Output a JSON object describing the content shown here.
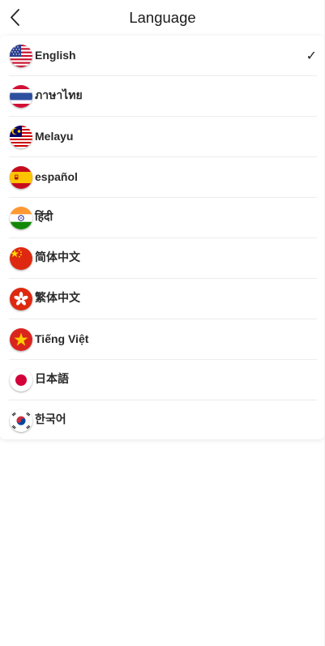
{
  "header": {
    "title": "Language"
  },
  "languages": [
    {
      "label": "English",
      "flag": "us-flag-icon",
      "selected": true
    },
    {
      "label": "ภาษาไทย",
      "flag": "thailand-flag-icon",
      "selected": false
    },
    {
      "label": "Melayu",
      "flag": "malaysia-flag-icon",
      "selected": false
    },
    {
      "label": "español",
      "flag": "spain-flag-icon",
      "selected": false
    },
    {
      "label": "हिंदी",
      "flag": "india-flag-icon",
      "selected": false
    },
    {
      "label": "简体中文",
      "flag": "china-flag-icon",
      "selected": false
    },
    {
      "label": "繁体中文",
      "flag": "hong-kong-flag-icon",
      "selected": false
    },
    {
      "label": "Tiếng Việt",
      "flag": "vietnam-flag-icon",
      "selected": false
    },
    {
      "label": "日本語",
      "flag": "japan-flag-icon",
      "selected": false
    },
    {
      "label": "한국어",
      "flag": "south-korea-flag-icon",
      "selected": false
    }
  ],
  "selected_mark": "✓",
  "colors": {
    "background": "#ffffff",
    "text": "#2a2a2a",
    "divider": "#ececec"
  }
}
